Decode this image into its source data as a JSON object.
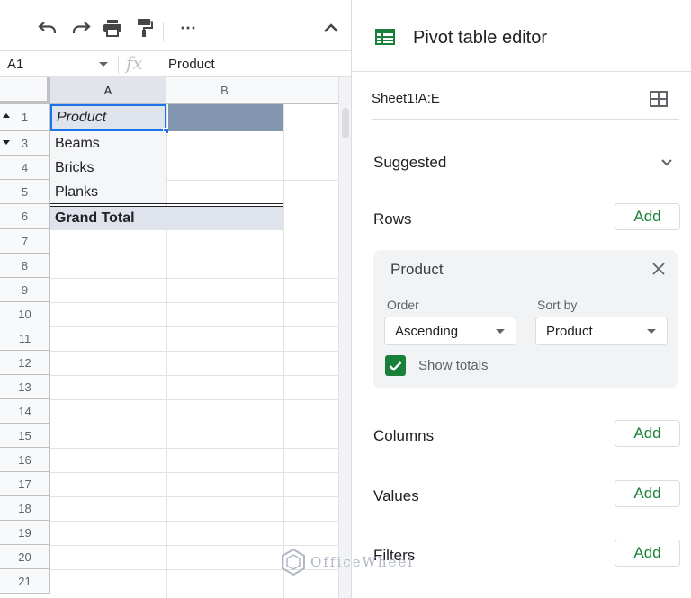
{
  "toolbar": {
    "undo_icon": "undo-icon",
    "redo_icon": "redo-icon",
    "print_icon": "print-icon",
    "paint_format_icon": "paint-format-icon",
    "more_label": "⋯",
    "collapse_icon": "chevron-up-icon"
  },
  "formula_bar": {
    "name_box": "A1",
    "fx_label": "fx",
    "value": "Product"
  },
  "grid": {
    "columns": [
      "A",
      "B"
    ],
    "rows": [
      "1",
      "3",
      "4",
      "5",
      "6",
      "7",
      "8",
      "9",
      "10",
      "11",
      "12",
      "13",
      "14",
      "15",
      "16",
      "17",
      "18",
      "19",
      "20",
      "21"
    ],
    "cells": {
      "header": "Product",
      "items": [
        "Beams",
        "Bricks",
        "Planks"
      ],
      "grand_total": "Grand Total"
    }
  },
  "panel": {
    "title": "Pivot table editor",
    "range": "Sheet1!A:E",
    "suggested_label": "Suggested",
    "rows_label": "Rows",
    "columns_label": "Columns",
    "values_label": "Values",
    "filters_label": "Filters",
    "add_label": "Add",
    "row_card": {
      "title": "Product",
      "order_label": "Order",
      "order_value": "Ascending",
      "sortby_label": "Sort by",
      "sortby_value": "Product",
      "show_totals_label": "Show totals",
      "show_totals_checked": true
    }
  },
  "watermark": "OfficeWheel",
  "colors": {
    "accent_green": "#188038",
    "header_selected": "#8497b0",
    "cell_highlight": "#dfe3eb"
  }
}
